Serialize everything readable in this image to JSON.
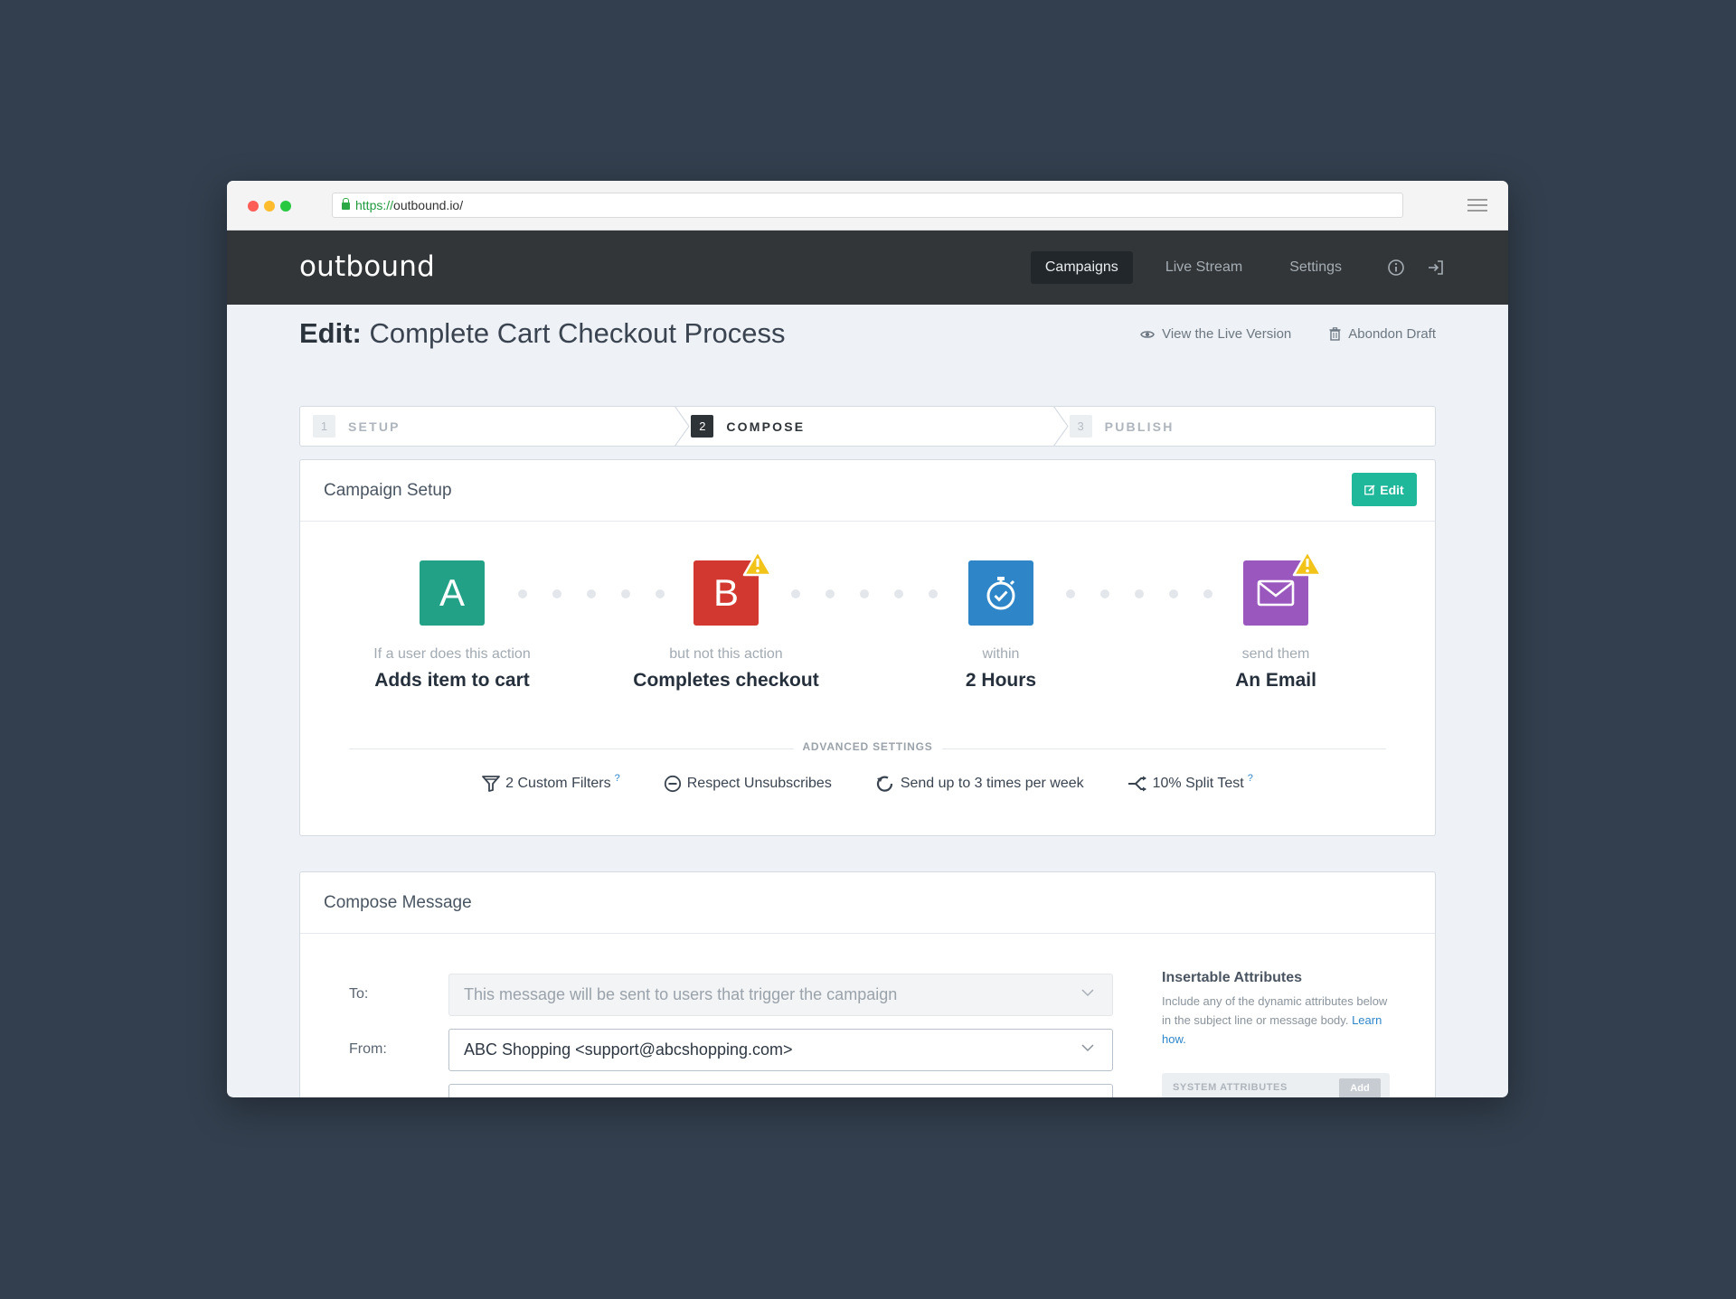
{
  "browser": {
    "url_scheme": "https://",
    "url_rest": "outbound.io/"
  },
  "app": {
    "logo": "outbound",
    "nav": [
      {
        "label": "Campaigns",
        "active": true
      },
      {
        "label": "Live Stream",
        "active": false
      },
      {
        "label": "Settings",
        "active": false
      }
    ]
  },
  "page": {
    "title_prefix": "Edit:",
    "title_name": "Complete Cart Checkout Process",
    "view_live": "View the Live Version",
    "abandon": "Abondon Draft"
  },
  "steps": [
    {
      "num": "1",
      "label": "SETUP",
      "active": false
    },
    {
      "num": "2",
      "label": "COMPOSE",
      "active": true
    },
    {
      "num": "3",
      "label": "PUBLISH",
      "active": false
    }
  ],
  "campaign_setup": {
    "title": "Campaign Setup",
    "edit_label": "Edit",
    "flow": [
      {
        "tile": "A",
        "color": "#23a187",
        "sub": "If a user does this action",
        "main": "Adds item to cart"
      },
      {
        "tile": "B",
        "color": "#d2382f",
        "sub": "but not this action",
        "main": "Completes checkout"
      },
      {
        "tile_icon": "stopwatch-icon",
        "color": "#2e86c9",
        "sub": "within",
        "main": "2 Hours"
      },
      {
        "tile_icon": "envelope-icon",
        "color": "#9a58be",
        "sub": "send them",
        "main": "An Email"
      }
    ],
    "advanced_label": "ADVANCED SETTINGS",
    "advanced": [
      {
        "icon": "filter-icon",
        "label": "2 Custom Filters",
        "help": "?"
      },
      {
        "icon": "minus-circle-icon",
        "label": "Respect Unsubscribes"
      },
      {
        "icon": "refresh-icon",
        "label": "Send up to 3 times per week"
      },
      {
        "icon": "split-icon",
        "label": "10% Split Test",
        "help": "?"
      }
    ]
  },
  "compose": {
    "title": "Compose Message",
    "to_label": "To:",
    "to_value": "This message will be sent to users that trigger the campaign",
    "from_label": "From:",
    "from_value": "ABC Shopping <support@abcshopping.com>",
    "side_title": "Insertable Attributes",
    "side_text": "Include any of the dynamic attributes below in the subject line or message body.",
    "side_link": "Learn how.",
    "attr_label": "SYSTEM ATTRIBUTES",
    "attr_add": "Add"
  },
  "colors": {
    "accent": "#1fb89a",
    "warning": "#f2c318"
  }
}
